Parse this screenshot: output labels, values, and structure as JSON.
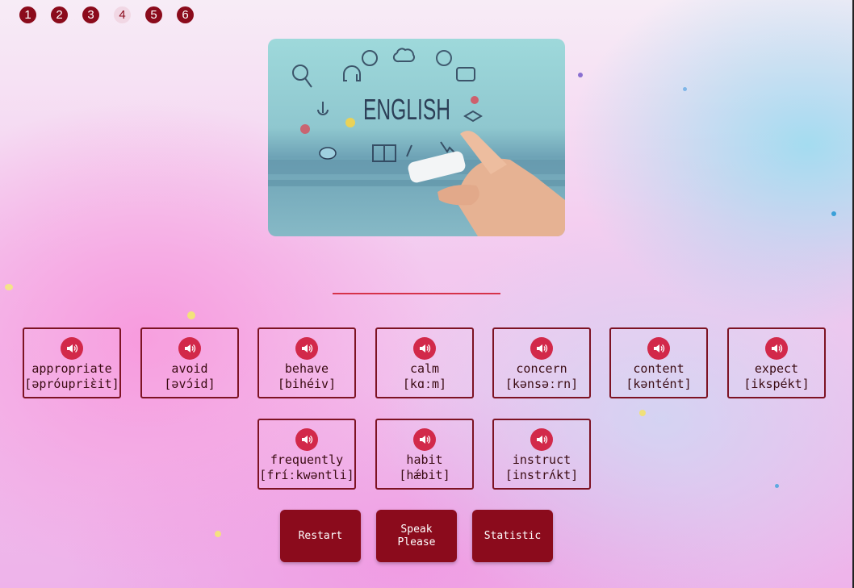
{
  "progress": {
    "steps": [
      "1",
      "2",
      "3",
      "4",
      "5",
      "6"
    ],
    "active_index": 3
  },
  "hero": {
    "word_art": "ENGLISH"
  },
  "words": [
    {
      "word": "appropriate",
      "phonetic": "[əpróupriὲit]"
    },
    {
      "word": "avoid",
      "phonetic": "[əvɔ́id]"
    },
    {
      "word": "behave",
      "phonetic": "[bihéiv]"
    },
    {
      "word": "calm",
      "phonetic": "[kɑːm]"
    },
    {
      "word": "concern",
      "phonetic": "[kənsəːrn]"
    },
    {
      "word": "content",
      "phonetic": "[kəntént]"
    },
    {
      "word": "expect",
      "phonetic": "[ikspékt]"
    },
    {
      "word": "frequently",
      "phonetic": "[fríːkwəntli]"
    },
    {
      "word": "habit",
      "phonetic": "[hǽbit]"
    },
    {
      "word": "instruct",
      "phonetic": "[instrʌ́kt]"
    }
  ],
  "buttons": {
    "restart": "Restart",
    "speak": "Speak\nPlease",
    "statistic": "Statistic"
  },
  "colors": {
    "accent": "#8b0b1c",
    "speaker": "#d2294a",
    "answer_line": "#d6324a"
  },
  "icons": {
    "speaker": "speaker-icon"
  }
}
